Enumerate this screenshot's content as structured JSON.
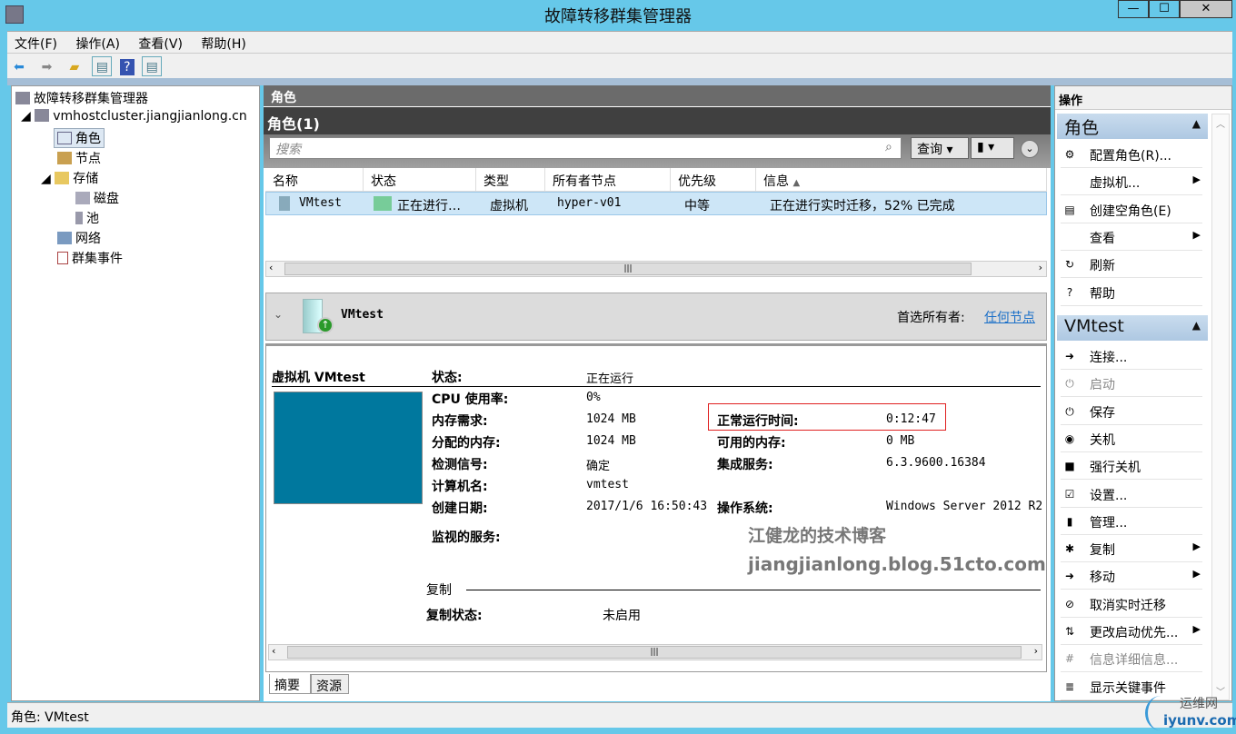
{
  "window": {
    "title": "故障转移群集管理器",
    "min": "—",
    "max": "☐",
    "close": "✕"
  },
  "menu": [
    "文件(F)",
    "操作(A)",
    "查看(V)",
    "帮助(H)"
  ],
  "tree": {
    "root": "故障转移群集管理器",
    "cluster": "vmhostcluster.jiangjianlong.cn",
    "roles": "角色",
    "nodes": "节点",
    "storage": "存储",
    "disks": "磁盘",
    "pools": "池",
    "network": "网络",
    "events": "群集事件"
  },
  "center": {
    "header": "角色",
    "list_title": "角色(1)",
    "search_placeholder": "搜索",
    "query_label": "查询",
    "columns": [
      "名称",
      "状态",
      "类型",
      "所有者节点",
      "优先级",
      "信息"
    ],
    "rows": [
      {
        "name": "VMtest",
        "status": "正在进行…",
        "type": "虚拟机",
        "owner": "hyper-v01",
        "priority": "中等",
        "info": "正在进行实时迁移，52% 已完成"
      }
    ]
  },
  "details": {
    "name": "VMtest",
    "preferred_owner_label": "首选所有者:",
    "preferred_owner_link": "任何节点",
    "section_title": "虚拟机 VMtest",
    "fields_left": [
      {
        "label": "状态:",
        "value": "正在运行"
      },
      {
        "label": "CPU 使用率:",
        "value": "0%"
      },
      {
        "label": "内存需求:",
        "value": "1024 MB"
      },
      {
        "label": "分配的内存:",
        "value": "1024 MB"
      },
      {
        "label": "检测信号:",
        "value": "确定"
      },
      {
        "label": "计算机名:",
        "value": "vmtest"
      },
      {
        "label": "创建日期:",
        "value": "2017/1/6 16:50:43"
      },
      {
        "label": "监视的服务:",
        "value": ""
      }
    ],
    "fields_right": [
      {
        "label": "正常运行时间:",
        "value": "0:12:47"
      },
      {
        "label": "可用的内存:",
        "value": "0 MB"
      },
      {
        "label": "集成服务:",
        "value": "6.3.9600.16384"
      },
      {
        "label": "操作系统:",
        "value": "Windows Server 2012 R2"
      }
    ],
    "replication_title": "复制",
    "replication_label": "复制状态:",
    "replication_value": "未启用",
    "watermark_cn": "江健龙的技术博客",
    "watermark_url": "jiangjianlong.blog.51cto.com",
    "tabs": [
      "摘要",
      "资源"
    ],
    "thumbnail_color": "#00789e"
  },
  "actions": {
    "header": "操作",
    "section1": "角色",
    "items1": [
      {
        "label": "配置角色(R)...",
        "icon": "⚙",
        "sub": false
      },
      {
        "label": "虚拟机...",
        "icon": "",
        "sub": true
      },
      {
        "label": "创建空角色(E)",
        "icon": "▤",
        "sub": false
      },
      {
        "label": "查看",
        "icon": "",
        "sub": true
      },
      {
        "label": "刷新",
        "icon": "↻",
        "sub": false
      },
      {
        "label": "帮助",
        "icon": "?",
        "sub": false
      }
    ],
    "section2": "VMtest",
    "items2": [
      {
        "label": "连接...",
        "icon": "➜",
        "sub": false,
        "dis": false
      },
      {
        "label": "启动",
        "icon": "⏻",
        "sub": false,
        "dis": true
      },
      {
        "label": "保存",
        "icon": "⏻",
        "sub": false,
        "dis": false
      },
      {
        "label": "关机",
        "icon": "◉",
        "sub": false,
        "dis": false
      },
      {
        "label": "强行关机",
        "icon": "■",
        "sub": false,
        "dis": false
      },
      {
        "label": "设置...",
        "icon": "☑",
        "sub": false,
        "dis": false
      },
      {
        "label": "管理...",
        "icon": "▮",
        "sub": false,
        "dis": false
      },
      {
        "label": "复制",
        "icon": "✱",
        "sub": true,
        "dis": false
      },
      {
        "label": "移动",
        "icon": "➜",
        "sub": true,
        "dis": false
      },
      {
        "label": "取消实时迁移",
        "icon": "⊘",
        "sub": false,
        "dis": false
      },
      {
        "label": "更改启动优先...",
        "icon": "⇅",
        "sub": true,
        "dis": false
      },
      {
        "label": "信息详细信息...",
        "icon": "#",
        "sub": false,
        "dis": true
      },
      {
        "label": "显示关键事件",
        "icon": "≣",
        "sub": false,
        "dis": false
      }
    ]
  },
  "status": {
    "text": "角色: VMtest"
  },
  "logo": {
    "cn": "运维网",
    "url": "iyunv.com"
  }
}
